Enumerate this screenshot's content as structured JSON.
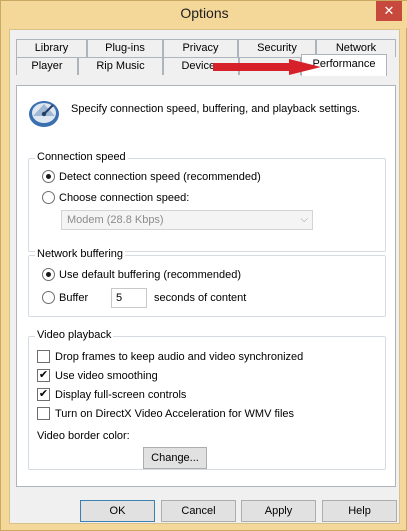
{
  "window": {
    "title": "Options",
    "close_glyph": "✕"
  },
  "tabs_row1": [
    "Library",
    "Plug-ins",
    "Privacy",
    "Security",
    "Network"
  ],
  "tabs_row2": [
    "Player",
    "Rip Music",
    "Devices",
    "",
    "Performance"
  ],
  "active_tab": "Performance",
  "intro": {
    "icon": "performance-gauge-icon",
    "text": "Specify connection speed, buffering, and playback settings."
  },
  "connection_speed": {
    "title": "Connection speed",
    "detect_label": "Detect connection speed (recommended)",
    "choose_label": "Choose connection speed:",
    "speed_value": "Modem (28.8 Kbps)",
    "selected": "detect"
  },
  "network_buffering": {
    "title": "Network buffering",
    "default_label": "Use default buffering (recommended)",
    "buffer_label": "Buffer",
    "buffer_value": "5",
    "seconds_label": "seconds of content",
    "selected": "default"
  },
  "video_playback": {
    "title": "Video playback",
    "drop_frames_label": "Drop frames to keep audio and video synchronized",
    "drop_frames_checked": false,
    "smoothing_label": "Use video smoothing",
    "smoothing_checked": true,
    "fullscreen_label": "Display full-screen controls",
    "fullscreen_checked": true,
    "directx_label": "Turn on DirectX Video Acceleration for WMV files",
    "directx_checked": false,
    "border_color_label": "Video border color:",
    "border_color": "#000000",
    "change_label": "Change..."
  },
  "buttons": {
    "ok": "OK",
    "cancel": "Cancel",
    "apply": "Apply",
    "help": "Help"
  },
  "annotation_color": "#d6202a"
}
